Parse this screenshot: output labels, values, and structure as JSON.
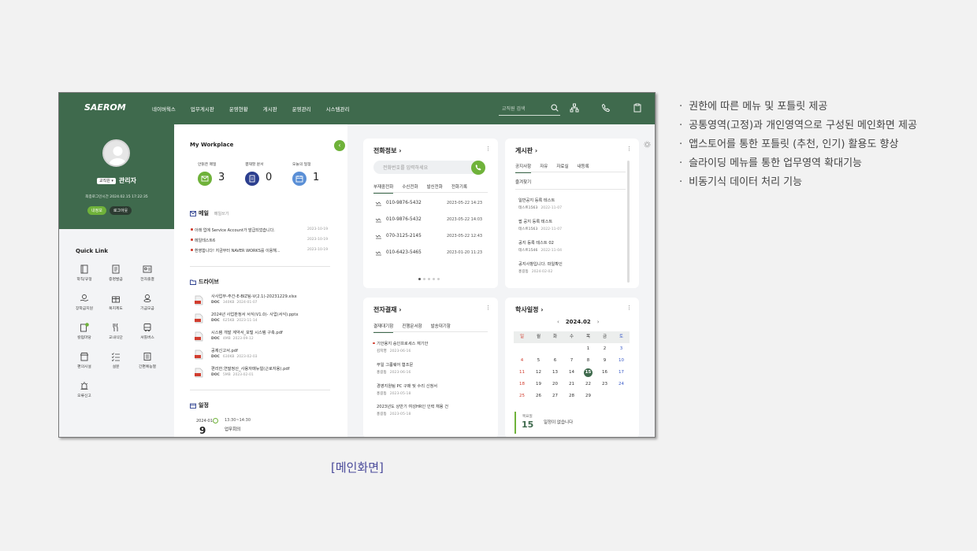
{
  "header": {
    "logo": "SAEROM",
    "nav": [
      "네이버웍스",
      "업무게시판",
      "운영현황",
      "게시판",
      "운영관리",
      "시스템관리"
    ],
    "search_placeholder": "교직원 검색"
  },
  "profile": {
    "role": "교직원 ▾",
    "name": "관리자",
    "last_login": "최종로그인시간 2024.02.15 17:22:35",
    "info_button": "내정보",
    "logout_button": "로그아웃"
  },
  "quick_link": {
    "title": "Quick Link",
    "items": [
      "학칙/규정",
      "증명발급",
      "전자출결",
      "장학금지원",
      "복지제도",
      "기금모금",
      "칼럼마당",
      "교내식단",
      "셔틀버스",
      "편의시설",
      "설문",
      "간편예능열",
      "오류신고"
    ]
  },
  "workplace": {
    "title": "My Workplace",
    "stats": [
      {
        "label": "안읽은 메일",
        "value": "3"
      },
      {
        "label": "결재할 문서",
        "value": "0"
      },
      {
        "label": "오늘의 일정",
        "value": "1"
      }
    ],
    "mail": {
      "title": "메일",
      "write": "메일쓰기",
      "items": [
        {
          "subject": "아래 업에 Service Account가 발급되었습니다.",
          "date": "2023-10-19"
        },
        {
          "subject": "메일테스트6",
          "date": "2023-10-19"
        },
        {
          "subject": "환영합니다! 지금부터 NAVER WORKS를 이용해...",
          "date": "2023-10-19"
        }
      ]
    },
    "drive": {
      "title": "드라이브",
      "files": [
        {
          "name": "사사업부-주간-E-BIZ팀-V(2.1)-20231229.xlsx",
          "type": "DOC",
          "size": "340KB",
          "date": "2024-01-07"
        },
        {
          "name": "2024년 사업판정서 서식(V1.0)- 사업(서식).pptx",
          "type": "DOC",
          "size": "625KB",
          "date": "2023-11-14"
        },
        {
          "name": "시스템 개발 계약서_포털 시스템 구축.pdf",
          "type": "DOC",
          "size": "4MB",
          "date": "2023-09-12"
        },
        {
          "name": "공제신고서.pdf",
          "type": "DOC",
          "size": "630KB",
          "date": "2023-02-03"
        },
        {
          "name": "편리한,연말정산_사용자매뉴얼(근로자용).pdf",
          "type": "DOC",
          "size": "5MB",
          "date": "2023-02-01"
        }
      ]
    },
    "schedule": {
      "title": "일정",
      "month": "2024-01",
      "day": "9",
      "time": "13:30~14:30",
      "event": "업무회의"
    }
  },
  "phone": {
    "title": "전화정보",
    "placeholder": "전화번호를 입력하세요",
    "tabs": [
      "부재중전화",
      "수신전화",
      "발신전화",
      "전화기록"
    ],
    "rows": [
      {
        "number": "010-9876-5432",
        "date": "2023-05-22 14:23"
      },
      {
        "number": "010-9876-5432",
        "date": "2023-05-22 14:03"
      },
      {
        "number": "070-3125-2145",
        "date": "2023-05-22 12:43"
      },
      {
        "number": "010-6423-5465",
        "date": "2023-01-20 11:23"
      }
    ]
  },
  "board": {
    "title": "게시판",
    "tabs": [
      "공지사항",
      "자유",
      "자료실",
      "내등록",
      "즐겨찾기"
    ],
    "items": [
      {
        "title": "일반공지 등록 테스트",
        "author": "테스트1563",
        "date": "2022-11-07"
      },
      {
        "title": "팝 공지 등록 테스트",
        "author": "테스트1563",
        "date": "2022-11-07"
      },
      {
        "title": "공지 등록 테스트 02",
        "author": "테스트1546",
        "date": "2022-11-04"
      },
      {
        "title": "공지사항입니다. 파일확인",
        "author": "홍길동",
        "date": "2024-02-02"
      }
    ]
  },
  "approval": {
    "title": "전자결재",
    "tabs": [
      "결재대기함",
      "진행문서함",
      "발송대기함"
    ],
    "items": [
      {
        "title": "기안용지 승인프로세스 재기안",
        "author": "김지영",
        "date": "2023-06-16"
      },
      {
        "title": "부일 그룹웨어 협조문",
        "author": "홍길동",
        "date": "2023-06-16"
      },
      {
        "title": "경영지원팀 PC 구매 및 수리 신청서",
        "author": "홍길동",
        "date": "2023-05-18"
      },
      {
        "title": "2023년도 상반기 여성HR인 인력 채용 건",
        "author": "홍길동",
        "date": "2023-05-18"
      }
    ]
  },
  "calendar": {
    "title": "학사일정",
    "month": "2024.02",
    "weekdays": [
      "일",
      "월",
      "화",
      "수",
      "목",
      "금",
      "토"
    ],
    "weeks": [
      [
        "",
        "",
        "",
        "",
        "1",
        "2",
        "3"
      ],
      [
        "4",
        "5",
        "6",
        "7",
        "8",
        "9",
        "10"
      ],
      [
        "11",
        "12",
        "13",
        "14",
        "15",
        "16",
        "17"
      ],
      [
        "18",
        "19",
        "20",
        "21",
        "22",
        "23",
        "24"
      ],
      [
        "25",
        "26",
        "27",
        "28",
        "29",
        "",
        ""
      ]
    ],
    "today": "15",
    "today_dow": "목요일",
    "today_msg": "일정이 없습니다"
  },
  "caption": "[메인화면]",
  "notes": [
    "권한에 따른 메뉴 및 포틀릿 제공",
    "공통영역(고정)과 개인영역으로 구성된 메인화면 제공",
    "앱스토어를 통한 포틀릿 (추천, 인기) 활용도 향상",
    "슬라이딩 메뉴를 통한 업무영역 확대기능",
    "비동기식 데이터 처리 기능"
  ],
  "colors": {
    "brand_green": "#3f6a4d",
    "accent_green": "#6fb23a",
    "sunday": "#d13c2e",
    "saturday": "#3a5bc8"
  }
}
